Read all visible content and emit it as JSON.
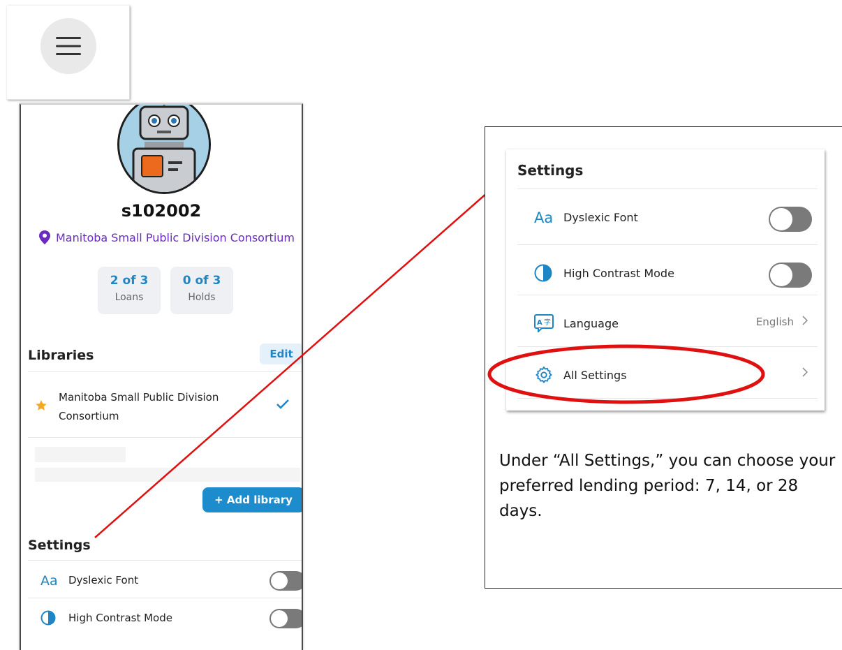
{
  "menu": {
    "icon": "hamburger-menu-icon"
  },
  "profile": {
    "avatar_icon": "robot-avatar-icon",
    "username": "s102002",
    "library_name": "Manitoba Small Public Division Consortium",
    "stats": [
      {
        "value": "2 of 3",
        "label": "Loans"
      },
      {
        "value": "0 of 3",
        "label": "Holds"
      }
    ]
  },
  "libraries": {
    "title": "Libraries",
    "edit_label": "Edit",
    "items": [
      {
        "name": "Manitoba Small Public Division Consortium",
        "selected": true
      }
    ],
    "add_label": "+ Add library"
  },
  "settings_phone": {
    "title": "Settings",
    "items": [
      {
        "label": "Dyslexic Font",
        "icon": "font-aa-icon",
        "toggle": false
      },
      {
        "label": "High Contrast Mode",
        "icon": "contrast-icon",
        "toggle": false
      }
    ]
  },
  "settings_zoom": {
    "title": "Settings",
    "items": [
      {
        "label": "Dyslexic Font",
        "icon": "font-aa-icon",
        "toggle": false
      },
      {
        "label": "High Contrast Mode",
        "icon": "contrast-icon",
        "toggle": false
      },
      {
        "label": "Language",
        "icon": "language-icon",
        "value": "English"
      },
      {
        "label": "All Settings",
        "icon": "gear-icon"
      }
    ]
  },
  "callout": {
    "text": "Under “All Settings,” you can choose your preferred lending period: 7, 14, or 28 days."
  },
  "colors": {
    "accent_blue": "#1c8ccd",
    "library_purple": "#6a2bbf",
    "annotation_red": "#e01010",
    "toggle_off": "#7a7a7a"
  }
}
